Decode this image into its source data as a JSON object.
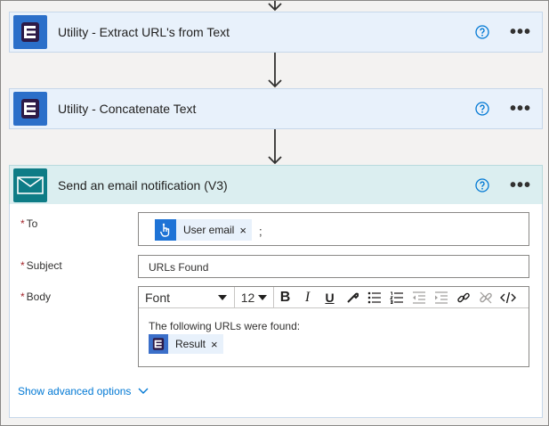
{
  "steps": [
    {
      "title": "Utility - Extract URL's from Text"
    },
    {
      "title": "Utility - Concatenate Text"
    }
  ],
  "email_step": {
    "title": "Send an email notification (V3)",
    "to_label": "To",
    "subject_label": "Subject",
    "body_label": "Body",
    "to_token": "User email",
    "to_separator": ";",
    "subject_value": "URLs Found",
    "toolbar": {
      "font": "Font",
      "size": "12"
    },
    "body_text": "The following URLs were found:",
    "body_token": "Result",
    "show_advanced": "Show advanced options"
  },
  "icons": {
    "more": "•••",
    "token_close": "×",
    "required": "*"
  },
  "colors": {
    "utility_header": "#e8f1fb",
    "email_header": "#dbeef0",
    "link": "#0078d4",
    "required": "#a4262c"
  }
}
